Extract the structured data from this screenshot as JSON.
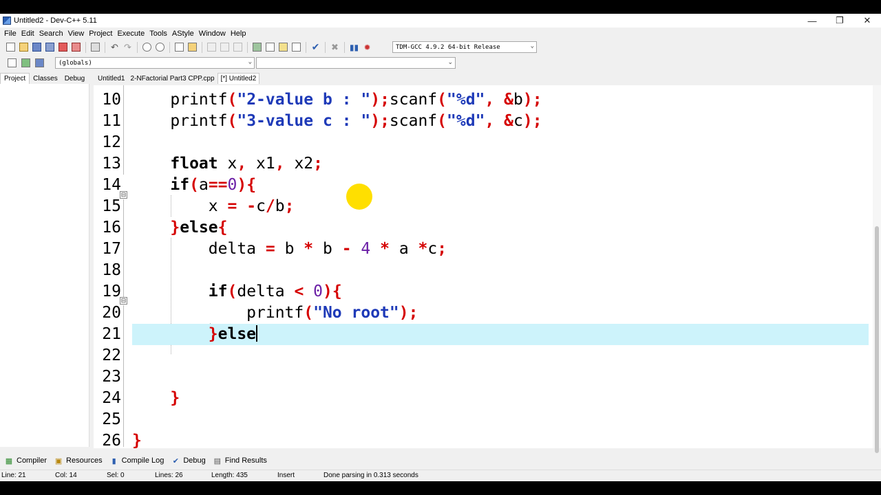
{
  "window": {
    "title": "Untitled2 - Dev-C++ 5.11",
    "controls": {
      "minimize": "—",
      "maximize": "❐",
      "close": "✕"
    }
  },
  "menu": [
    "File",
    "Edit",
    "Search",
    "View",
    "Project",
    "Execute",
    "Tools",
    "AStyle",
    "Window",
    "Help"
  ],
  "toolbar": {
    "compiler": "TDM-GCC 4.9.2 64-bit Release",
    "globals": "(globals)"
  },
  "left_tabs": [
    "Project",
    "Classes",
    "Debug"
  ],
  "file_tabs": [
    "Untitled1",
    "2-NFactorial Part3 CPP.cpp",
    "[*] Untitled2"
  ],
  "editor": {
    "line_numbers": [
      "10",
      "11",
      "12",
      "13",
      "14",
      "15",
      "16",
      "17",
      "18",
      "19",
      "20",
      "21",
      "22",
      "23",
      "24",
      "25",
      "26"
    ],
    "current_line": "21"
  },
  "bottom_tabs": {
    "compiler": "Compiler",
    "resources": "Resources",
    "compile_log": "Compile Log",
    "debug": "Debug",
    "find_results": "Find Results"
  },
  "status": {
    "line": "Line:   21",
    "col": "Col:   14",
    "sel": "Sel:   0",
    "lines": "Lines:   26",
    "length": "Length:   435",
    "mode": "Insert",
    "message": "Done parsing in 0.313 seconds"
  },
  "colors": {
    "current_line_bg": "#cdf3fb",
    "keyword": "#000000",
    "operator": "#d50000",
    "string": "#1e3ab8",
    "number": "#6b1fa6",
    "pointer": "#ffdf00"
  }
}
